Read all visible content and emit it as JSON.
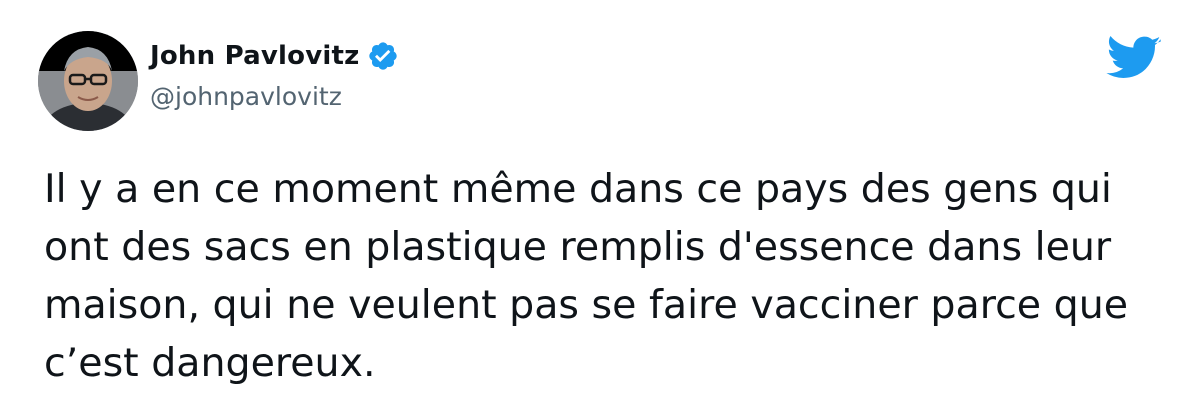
{
  "author": {
    "display_name": "John Pavlovitz",
    "handle": "@johnpavlovitz",
    "verified": true
  },
  "tweet": {
    "text": "Il y a en ce moment même dans ce pays des gens qui\nont des sacs en plastique remplis d'essence dans leur\nmaison, qui ne veulent pas se faire vacciner parce que\nc’est dangereux."
  },
  "icons": {
    "brand": "twitter-bird-icon",
    "verified": "verified-badge-icon"
  },
  "colors": {
    "brand_blue": "#1d9bf0",
    "text": "#0f1419",
    "secondary_text": "#536471",
    "background": "#ffffff"
  }
}
